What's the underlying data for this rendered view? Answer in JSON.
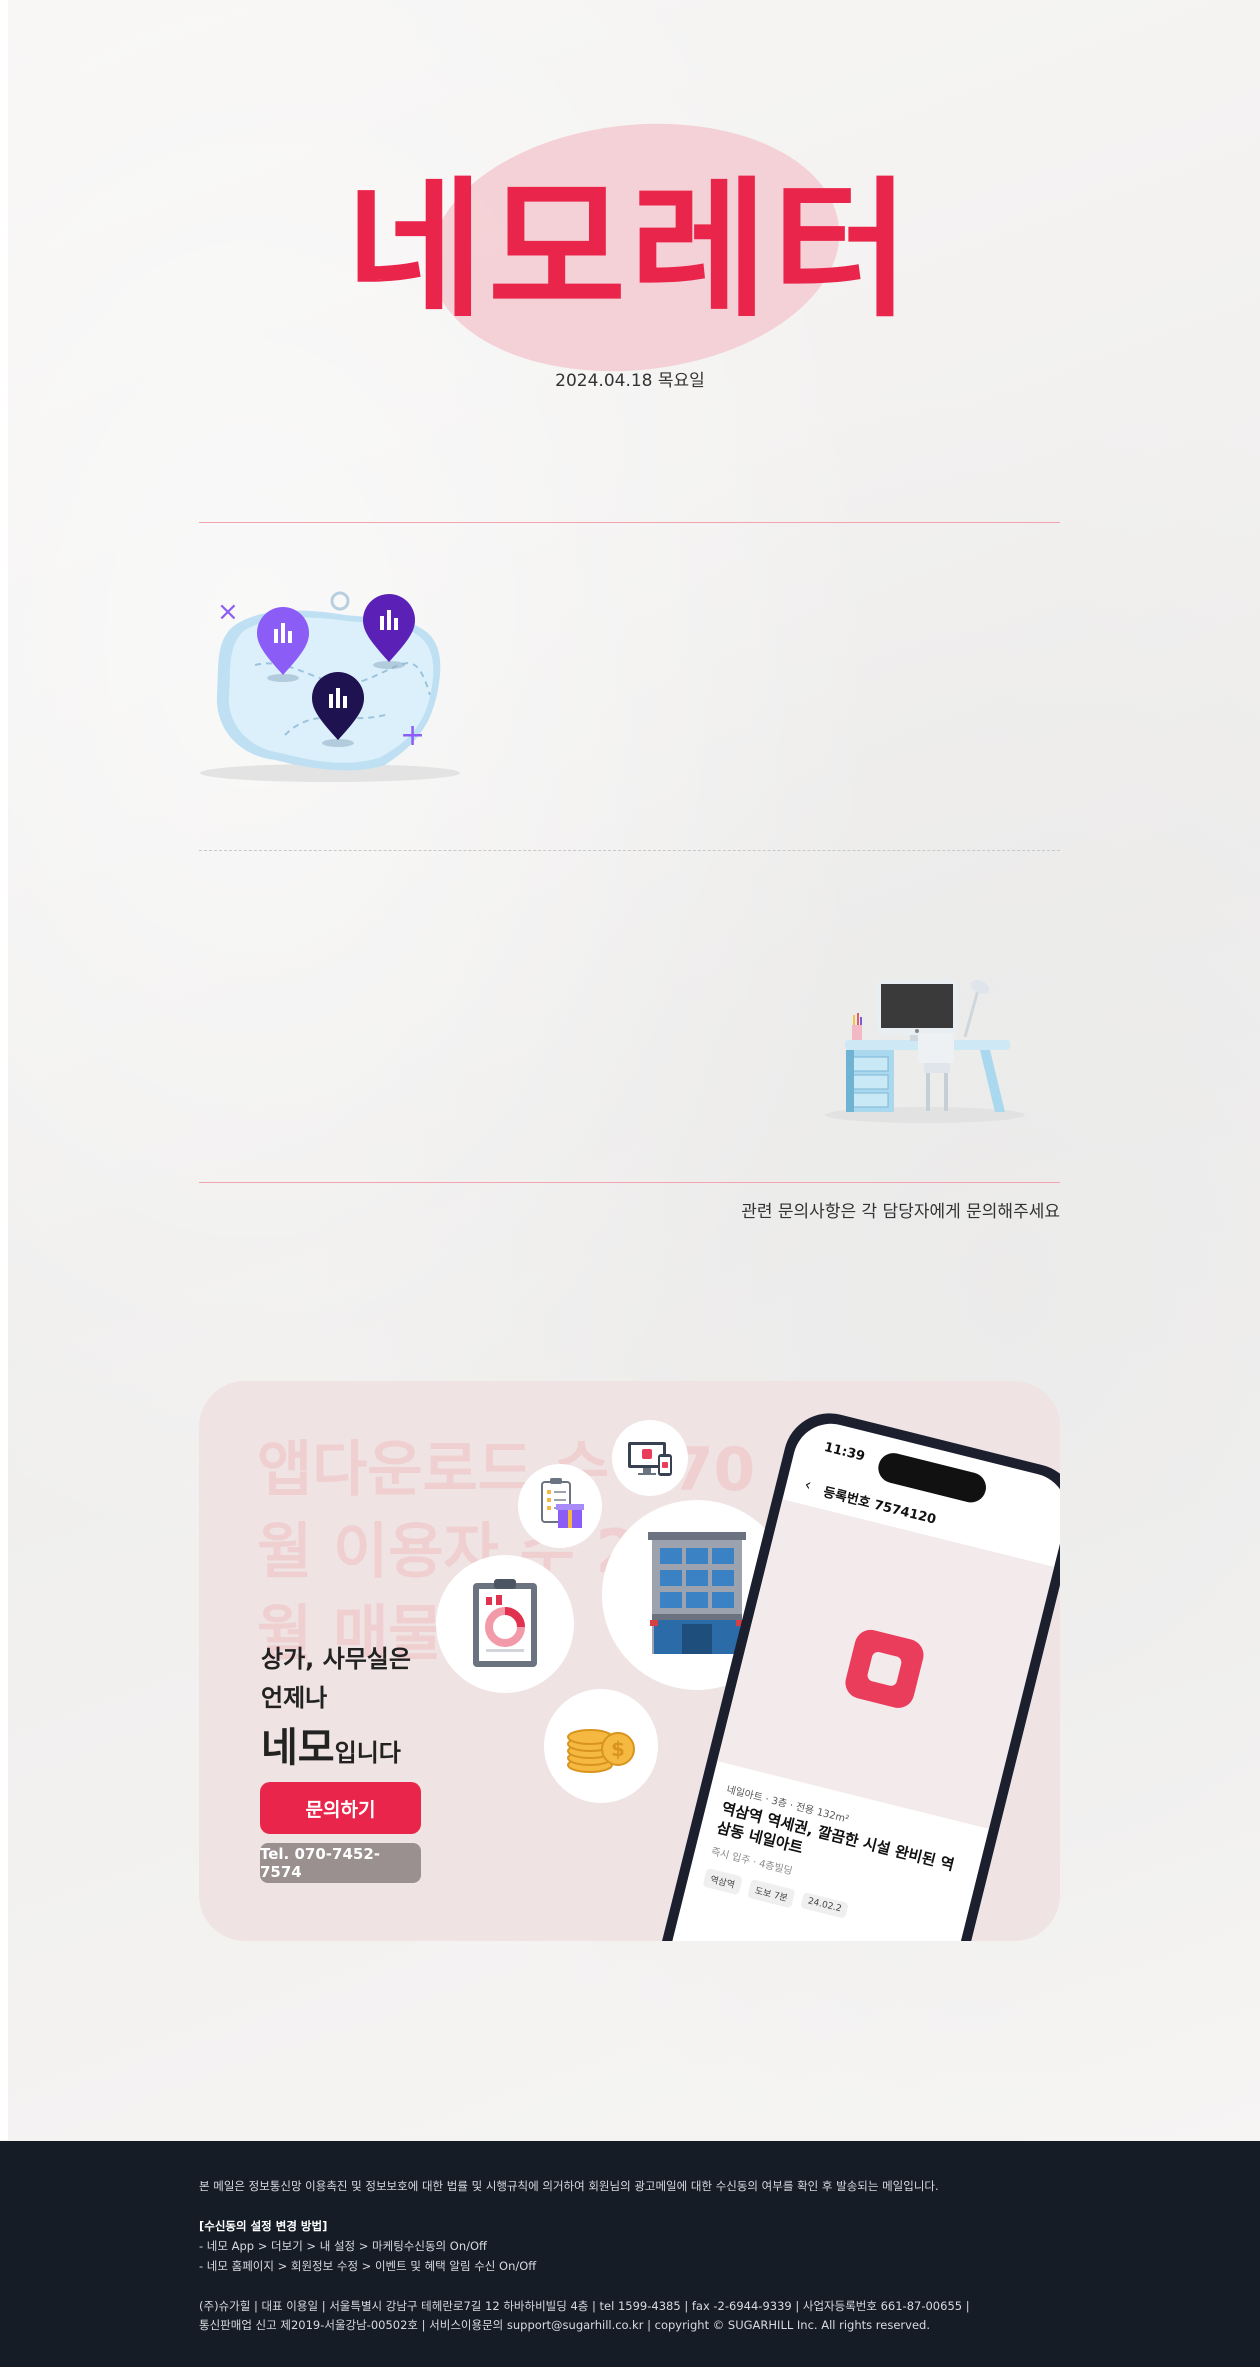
{
  "header": {
    "brand": "네모레터",
    "date": "2024.04.18 목요일"
  },
  "illustrations": {
    "map_icon": "map-pins-illustration",
    "desk_icon": "office-desk-illustration"
  },
  "notice": "관련 문의사항은 각 담당자에게 문의해주세요",
  "banner": {
    "ghost_line1": "앱다운로드 수 370",
    "ghost_line2": "월 이용자 수 2",
    "ghost_line3": "월 매물",
    "line1": "상가, 사무실은",
    "line2": "언제나",
    "big": "네모",
    "big_suffix": "입니다",
    "ask_button": "문의하기",
    "tel_button": "Tel. 070-7452-7574",
    "phone": {
      "time": "11:39",
      "register_no": "등록번호 7574120",
      "meta": "네일아트 · 3층 · 전용 132m²",
      "title": "역삼역 역세권, 깔끔한 시설 완비된 역삼동 네일아트",
      "sub": "즉시 입주 · 4층빌딩",
      "chips": [
        "역삼역",
        "도보 7분",
        "24.02.2"
      ]
    }
  },
  "footer": {
    "disclaimer": "본 메일은 정보통신망 이용촉진 및 정보보호에 대한 법률 및 시행규칙에 의거하여 회원님의 광고메일에 대한 수신동의 여부를 확인 후 발송되는 메일입니다.",
    "settings_title": "[수신동의 설정 변경 방법]",
    "settings_1": "- 네모 App > 더보기 > 내 설정 > 마케팅수신동의 On/Off",
    "settings_2": "- 네모 홈페이지 > 회원정보 수정 > 이벤트 및 혜택 알림 수신 On/Off",
    "company_1": "(주)슈가힐 | 대표 이용일 | 서울특별시 강남구 테헤란로7길 12 하바하비빌딩 4층 | tel 1599-4385 | fax -2-6944-9339 | 사업자등록번호 661-87-00655 |",
    "company_2": "통신판매업 신고 제2019-서울강남-00502호 | 서비스이용문의 support@sugarhill.co.kr | copyright © SUGARHILL Inc. All rights reserved."
  },
  "colors": {
    "accent": "#ea254b",
    "banner_bg": "#efe3e3",
    "footer_bg": "#161c26"
  }
}
